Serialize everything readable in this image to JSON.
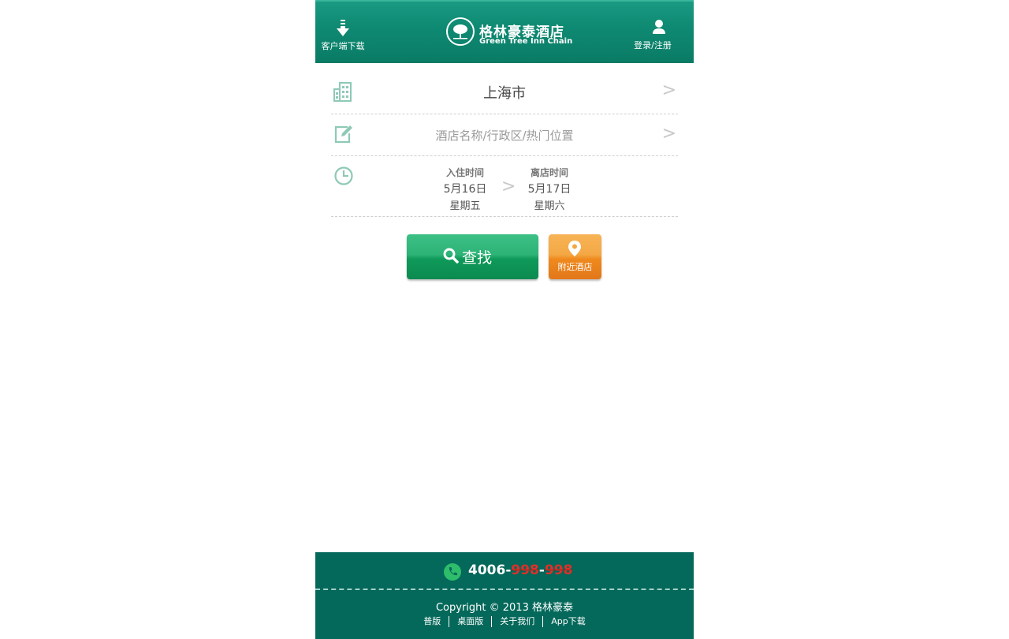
{
  "header": {
    "download_label": "客户端下载",
    "logo_cn": "格林豪泰酒店",
    "logo_en": "Green Tree Inn Chain",
    "login_label": "登录/注册"
  },
  "search": {
    "city": "上海市",
    "keyword_placeholder": "酒店名称/行政区/热门位置",
    "arrow": ">",
    "checkin": {
      "title": "入住时间",
      "date": "5月16日",
      "weekday": "星期五"
    },
    "checkout": {
      "title": "离店时间",
      "date": "5月17日",
      "weekday": "星期六"
    }
  },
  "actions": {
    "search_label": "查找",
    "nearby_label": "附近酒店"
  },
  "footer": {
    "phone_prefix": "4006-",
    "phone_mid": "998",
    "phone_dash": "-",
    "phone_end": "998",
    "copyright": "Copyright © 2013 格林豪泰",
    "links": [
      "普版",
      "桌面版",
      "关于我们",
      "App下载"
    ]
  },
  "colors": {
    "header_green": "#0f8a73",
    "footer_green": "#04685a",
    "search_button": "#2eb377",
    "nearby_button": "#f4a844",
    "phone_red": "#e0302a"
  }
}
